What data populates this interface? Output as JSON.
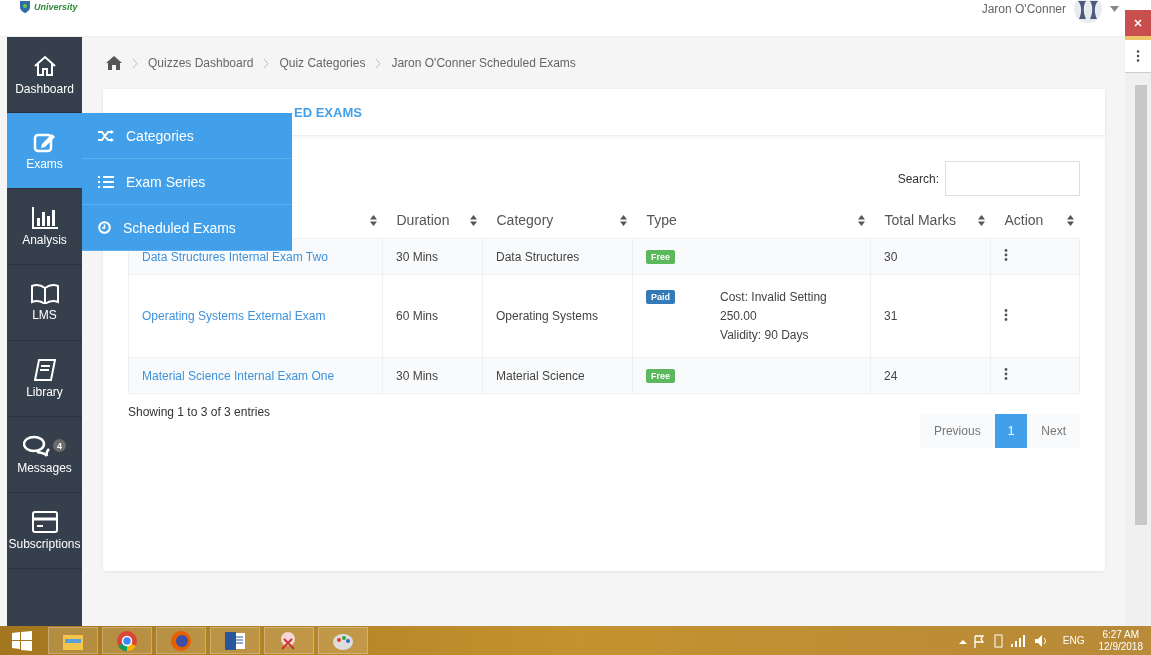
{
  "logo": {
    "text": "University"
  },
  "user": {
    "name": "Jaron O'Conner"
  },
  "sidebar": {
    "items": [
      {
        "label": "Dashboard",
        "selected": false
      },
      {
        "label": "Exams",
        "selected": true
      },
      {
        "label": "Analysis",
        "selected": false
      },
      {
        "label": "LMS",
        "selected": false
      },
      {
        "label": "Library",
        "selected": false
      },
      {
        "label": "Messages",
        "selected": false,
        "badge": "4"
      },
      {
        "label": "Subscriptions",
        "selected": false
      }
    ]
  },
  "flyout": {
    "items": [
      {
        "label": "Categories"
      },
      {
        "label": "Exam Series"
      },
      {
        "label": "Scheduled Exams"
      }
    ]
  },
  "breadcrumb": [
    "Quizzes Dashboard",
    "Quiz Categories",
    "Jaron O'Conner Scheduled Exams"
  ],
  "card": {
    "title": "ED EXAMS"
  },
  "search": {
    "label": "Search:"
  },
  "table": {
    "columns": [
      {},
      {
        "label": "Duration"
      },
      {
        "label": "Category"
      },
      {
        "label": "Type"
      },
      {
        "label": "Total Marks"
      },
      {
        "label": "Action"
      }
    ],
    "rows": [
      {
        "title": "Data Structures Internal Exam Two",
        "duration": "30 Mins",
        "category": "Data Structures",
        "type": {
          "kind": "free",
          "badge": "Free"
        },
        "marks": "30"
      },
      {
        "title": "Operating Systems External Exam",
        "duration": "60 Mins",
        "category": "Operating Systems",
        "type": {
          "kind": "paid",
          "badge": "Paid",
          "details": [
            "Cost: Invalid Setting",
            "250.00",
            "Validity: 90 Days"
          ]
        },
        "marks": "31"
      },
      {
        "title": "Material Science Internal Exam One",
        "duration": "30 Mins",
        "category": "Material Science",
        "type": {
          "kind": "free",
          "badge": "Free"
        },
        "marks": "24"
      }
    ]
  },
  "info": "Showing 1 to 3 of 3 entries",
  "pagination": [
    {
      "label": "Previous",
      "selected": false
    },
    {
      "label": "1",
      "selected": true
    },
    {
      "label": "Next",
      "selected": false
    }
  ],
  "taskbar": {
    "language": "ENG",
    "time": "6:27 AM",
    "date": "12/9/2018"
  }
}
